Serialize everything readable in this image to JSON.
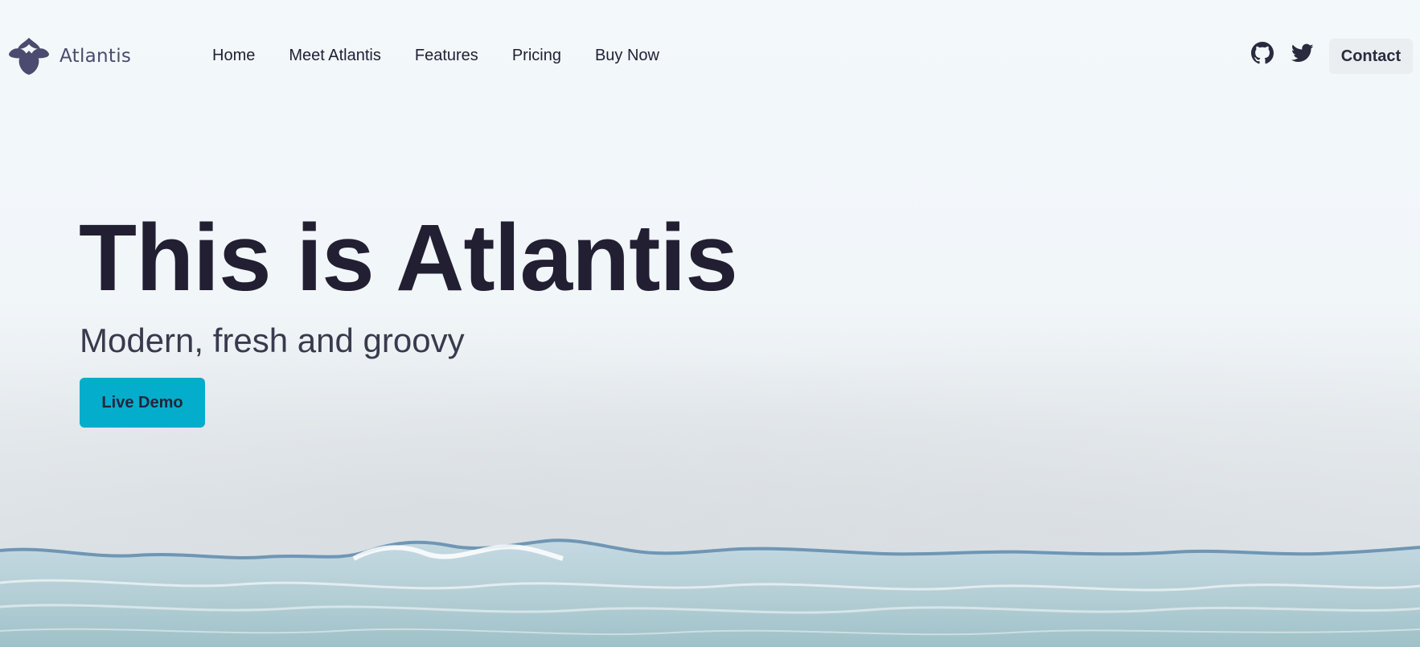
{
  "brand": {
    "name": "Atlantis",
    "logo_icon": "atlantis-scales-logo-icon",
    "logo_color": "#4a4b6e"
  },
  "nav": {
    "items": [
      {
        "label": "Home"
      },
      {
        "label": "Meet Atlantis"
      },
      {
        "label": "Features"
      },
      {
        "label": "Pricing"
      },
      {
        "label": "Buy Now"
      }
    ]
  },
  "social": {
    "github_icon": "github-icon",
    "twitter_icon": "twitter-icon"
  },
  "header": {
    "contact_label": "Contact"
  },
  "hero": {
    "title": "This is Atlantis",
    "subtitle": "Modern, fresh and groovy",
    "cta_label": "Live Demo",
    "cta_color": "#04adcb",
    "background": "ocean-beach-aerial"
  }
}
